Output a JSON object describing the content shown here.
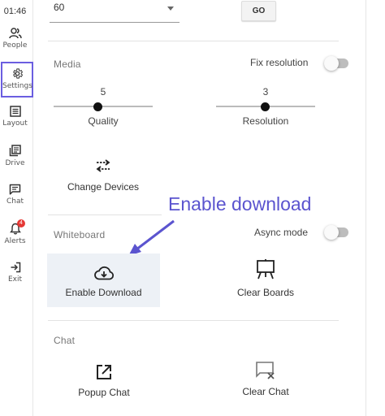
{
  "sidebar": {
    "time": "01:46",
    "items": [
      {
        "label": "People",
        "icon": "people-icon"
      },
      {
        "label": "Settings",
        "icon": "gear-icon",
        "active": true
      },
      {
        "label": "Layout",
        "icon": "layout-icon"
      },
      {
        "label": "Drive",
        "icon": "drive-icon"
      },
      {
        "label": "Chat",
        "icon": "chat-icon"
      },
      {
        "label": "Alerts",
        "icon": "bell-icon",
        "badge": "4"
      },
      {
        "label": "Exit",
        "icon": "exit-icon"
      }
    ]
  },
  "top": {
    "select_value": "60",
    "go_label": "GO"
  },
  "media": {
    "title": "Media",
    "fix_resolution_label": "Fix resolution",
    "quality": {
      "value": "5",
      "label": "Quality"
    },
    "resolution": {
      "value": "3",
      "label": "Resolution"
    },
    "change_devices_label": "Change Devices"
  },
  "whiteboard": {
    "title": "Whiteboard",
    "async_label": "Async mode",
    "enable_download_label": "Enable Download",
    "clear_boards_label": "Clear Boards"
  },
  "chat": {
    "title": "Chat",
    "popup_label": "Popup Chat",
    "clear_label": "Clear Chat"
  },
  "annotation": {
    "text": "Enable download"
  },
  "colors": {
    "accent": "#6b5ee0",
    "annotation": "#5b54cf",
    "badge": "#e53935",
    "highlight_tile": "#edf1f6"
  }
}
